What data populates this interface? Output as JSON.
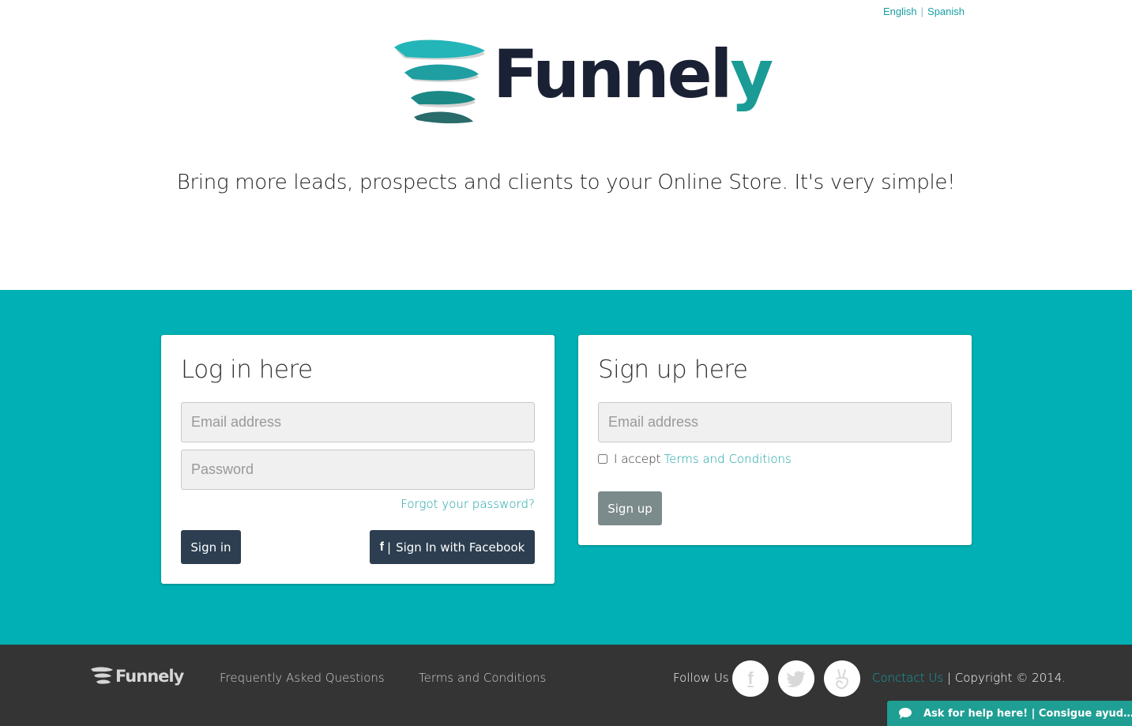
{
  "header": {
    "languages": [
      "English",
      "Spanish"
    ],
    "brand": {
      "name_main": "Funnel",
      "name_accent": "y"
    },
    "tagline": "Bring more leads, prospects and clients to your Online Store. It's very simple!"
  },
  "login": {
    "title": "Log in here",
    "email_placeholder": "Email address",
    "password_placeholder": "Password",
    "forgot_label": "Forgot your password?",
    "signin_label": "Sign in",
    "facebook_icon": "f",
    "facebook_label": "Sign In with Facebook"
  },
  "signup": {
    "title": "Sign up here",
    "email_placeholder": "Email address",
    "accept_label": "I accept",
    "terms_link": "Terms and Conditions",
    "signup_label": "Sign up"
  },
  "footer": {
    "brand": "Funnely",
    "faq_label": "Frequently Asked Questions",
    "terms_label": "Terms and Conditions",
    "follow_label": "Follow Us",
    "social_icons": [
      "facebook-icon",
      "twitter-icon",
      "angellist-icon"
    ],
    "contact_label": "Conctact Us",
    "copyright": "| Copyright © 2014."
  },
  "help_widget": {
    "label": "Ask for help here! | Consigue ayuda aquí!"
  },
  "colors": {
    "teal_band": "#00b0b4",
    "accent_link": "#17a0a3",
    "dark_button": "#2c3e50",
    "footer_bg": "#343434"
  }
}
